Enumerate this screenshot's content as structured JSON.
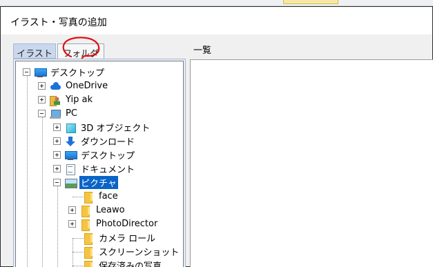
{
  "window": {
    "title": "イラスト・写真の追加"
  },
  "tabs": [
    {
      "label": "イラスト"
    },
    {
      "label": "フォルダ"
    }
  ],
  "list": {
    "label": "一覧"
  },
  "tree": {
    "items": [
      {
        "label": "デスクトップ",
        "icon": "desktop-icon",
        "selected": false
      },
      {
        "label": "OneDrive",
        "icon": "cloud-icon",
        "selected": false
      },
      {
        "label": "Yip ak",
        "icon": "user-folder-icon",
        "selected": false
      },
      {
        "label": "PC",
        "icon": "pc-icon",
        "selected": false
      },
      {
        "label": "3D オブジェクト",
        "icon": "cube-icon",
        "selected": false
      },
      {
        "label": "ダウンロード",
        "icon": "download-icon",
        "selected": false
      },
      {
        "label": "デスクトップ",
        "icon": "desktop-icon",
        "selected": false
      },
      {
        "label": "ドキュメント",
        "icon": "document-icon",
        "selected": false
      },
      {
        "label": "ピクチャ",
        "icon": "pictures-icon",
        "selected": true
      },
      {
        "label": "face",
        "icon": "folder-icon",
        "selected": false
      },
      {
        "label": "Leawo",
        "icon": "folder-icon",
        "selected": false
      },
      {
        "label": "PhotoDirector",
        "icon": "folder-icon",
        "selected": false
      },
      {
        "label": "カメラ ロール",
        "icon": "folder-icon",
        "selected": false
      },
      {
        "label": "スクリーンショット",
        "icon": "folder-icon",
        "selected": false
      },
      {
        "label": "保存済みの写真",
        "icon": "folder-icon",
        "selected": false
      }
    ]
  },
  "colors": {
    "selection": "#0a64c8",
    "annotation": "#e01010",
    "tab_active_bg": "#f7f7f7",
    "tab_inactive_bg": "#c9d8ee"
  }
}
